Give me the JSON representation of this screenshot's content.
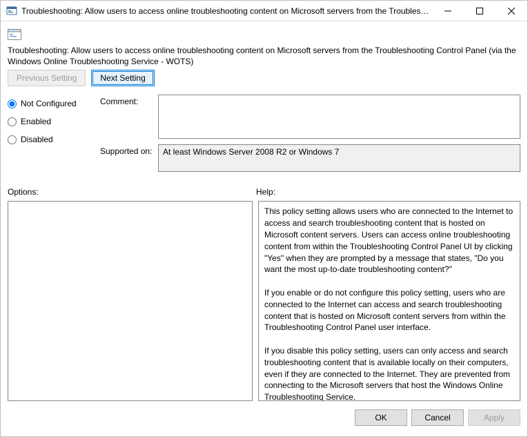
{
  "window": {
    "title": "Troubleshooting: Allow users to access online troubleshooting content on Microsoft servers from the Troublesh..."
  },
  "header": {
    "text": "Troubleshooting: Allow users to access online troubleshooting content on Microsoft servers from the Troubleshooting Control Panel (via the Windows Online Troubleshooting Service - WOTS)"
  },
  "nav": {
    "previous": "Previous Setting",
    "next": "Next Setting"
  },
  "state": {
    "options": [
      {
        "value": "not_configured",
        "label": "Not Configured"
      },
      {
        "value": "enabled",
        "label": "Enabled"
      },
      {
        "value": "disabled",
        "label": "Disabled"
      }
    ],
    "selected": "not_configured"
  },
  "fields": {
    "comment_label": "Comment:",
    "comment_value": "",
    "supported_label": "Supported on:",
    "supported_value": "At least Windows Server 2008 R2 or Windows 7"
  },
  "columns": {
    "options_label": "Options:",
    "help_label": "Help:"
  },
  "help": {
    "text": "This policy setting allows users who are connected to the Internet to access and search troubleshooting content that is hosted on Microsoft content servers. Users can access online troubleshooting content from within the Troubleshooting Control Panel UI by clicking \"Yes\" when they are prompted by a message that states, \"Do you want the most up-to-date troubleshooting content?\"\n\nIf you enable or do not configure this policy setting, users who are connected to the Internet can access and search troubleshooting content that is hosted on Microsoft content servers from within the Troubleshooting Control Panel user interface.\n\nIf you disable this policy setting, users can only access and search troubleshooting content that is available locally on their computers, even if they are connected to the Internet. They are prevented from connecting to the Microsoft servers that host the Windows Online Troubleshooting Service."
  },
  "footer": {
    "ok": "OK",
    "cancel": "Cancel",
    "apply": "Apply"
  }
}
